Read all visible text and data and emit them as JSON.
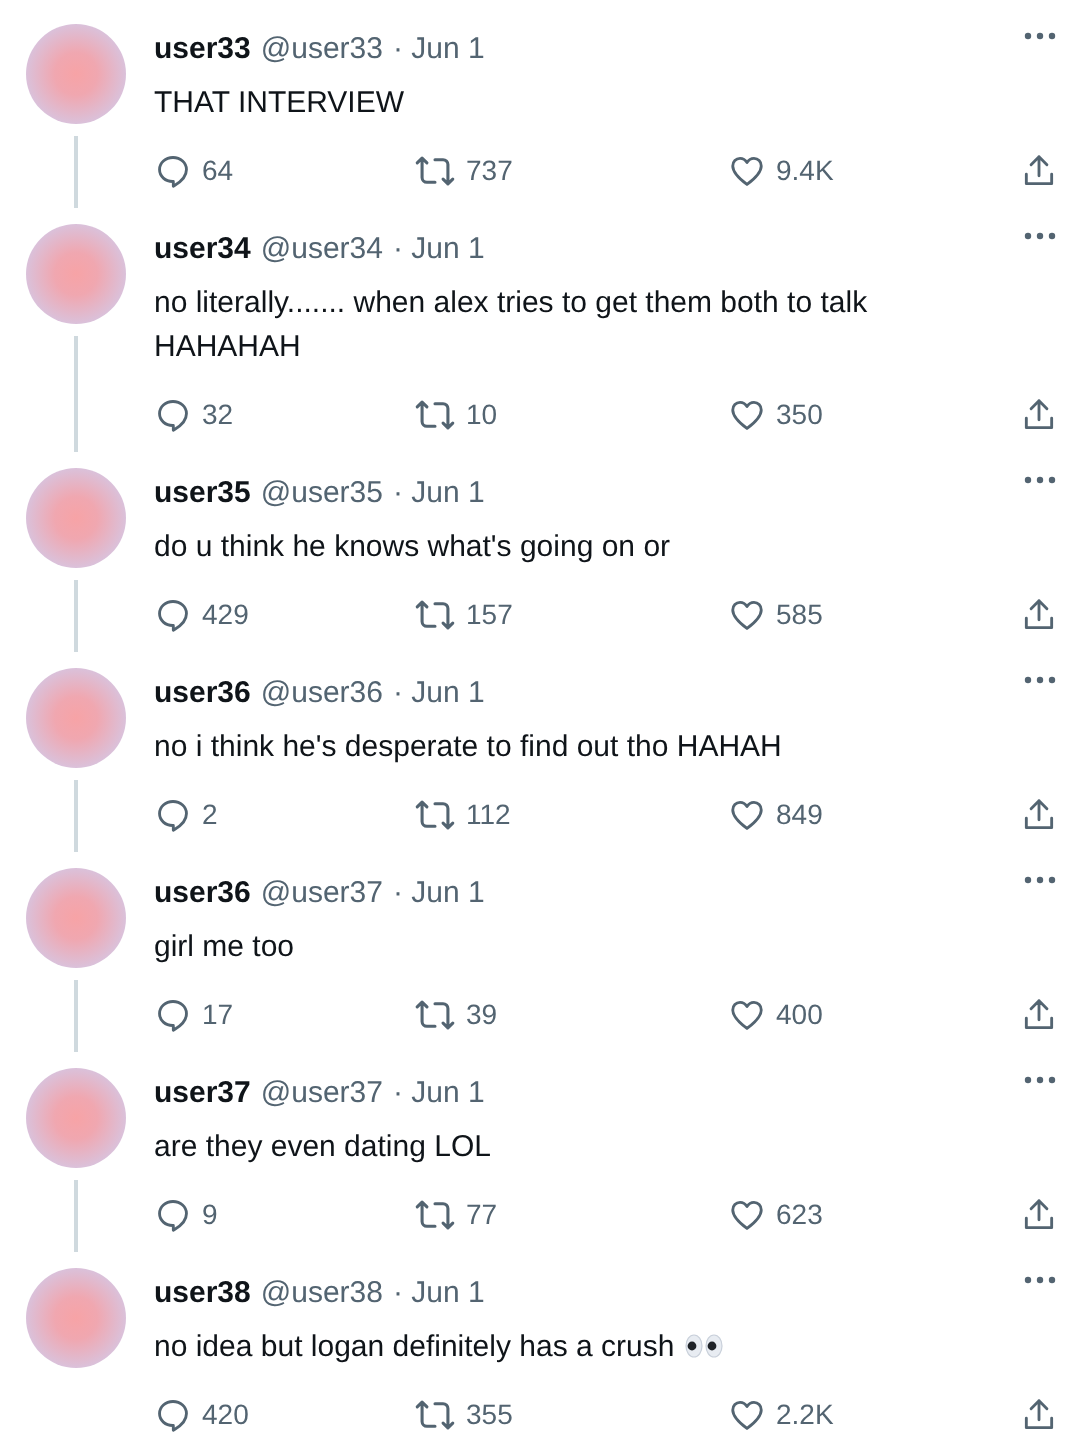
{
  "tweets": [
    {
      "kind": "plain",
      "name": "user33",
      "handle": "@user33",
      "date": "· Jun 1",
      "text": "THAT INTERVIEW",
      "replies": "64",
      "retweets": "737",
      "likes": "9.4K",
      "thread": true
    },
    {
      "kind": "plain",
      "name": "user34",
      "handle": "@user34",
      "date": "· Jun 1",
      "text": "no literally....... when alex tries to get them both to talk HAHAHAH",
      "replies": "32",
      "retweets": "10",
      "likes": "350",
      "thread": true
    },
    {
      "kind": "plain",
      "name": "user35",
      "handle": "@user35",
      "date": "· Jun 1",
      "text": "do u think he knows what's going on or",
      "replies": "429",
      "retweets": "157",
      "likes": "585",
      "thread": true
    },
    {
      "kind": "plain",
      "name": "user36",
      "handle": "@user36",
      "date": "· Jun 1",
      "text": "no i think he's desperate to find out tho HAHAH",
      "replies": "2",
      "retweets": "112",
      "likes": "849",
      "thread": true
    },
    {
      "kind": "plain",
      "name": "user36",
      "handle": "@user37",
      "date": "· Jun 1",
      "text": "girl me too",
      "replies": "17",
      "retweets": "39",
      "likes": "400",
      "thread": true
    },
    {
      "kind": "plain",
      "name": "user37",
      "handle": "@user37",
      "date": "· Jun 1",
      "text": "are they even dating LOL",
      "replies": "9",
      "retweets": "77",
      "likes": "623",
      "thread": true
    },
    {
      "kind": "eyes",
      "name": "user38",
      "handle": "@user38",
      "date": "· Jun 1",
      "text": "no idea but logan definitely has a crush",
      "replies": "420",
      "retweets": "355",
      "likes": "2.2K",
      "thread": false
    }
  ]
}
